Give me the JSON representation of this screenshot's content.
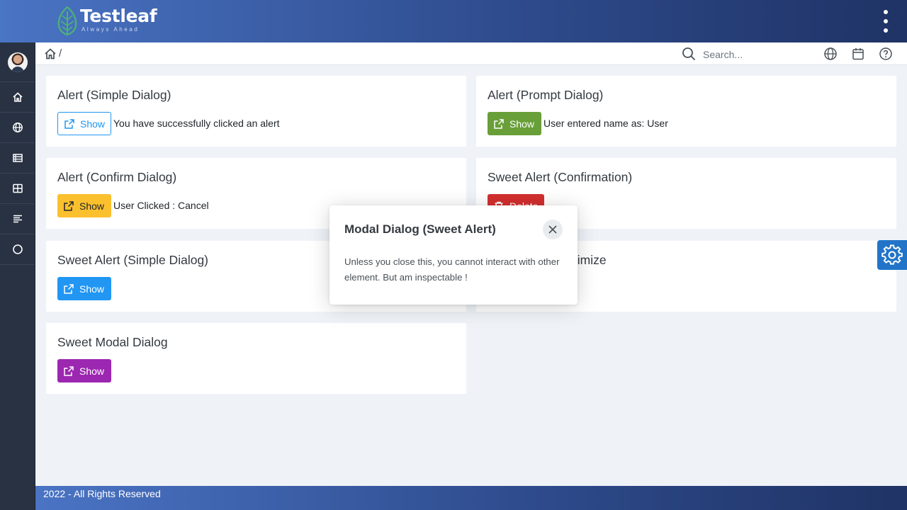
{
  "brand": {
    "name": "Testleaf",
    "tagline": "Always Ahead"
  },
  "breadcrumb": {
    "separator": "/"
  },
  "search": {
    "placeholder": "Search..."
  },
  "cards": {
    "simple_alert": {
      "title": "Alert (Simple Dialog)",
      "button": "Show",
      "result": "You have successfully clicked an alert"
    },
    "prompt_alert": {
      "title": "Alert (Prompt Dialog)",
      "button": "Show",
      "result": "User entered name as: User"
    },
    "confirm_alert": {
      "title": "Alert (Confirm Dialog)",
      "button": "Show",
      "result": "User Clicked : Cancel"
    },
    "sweet_confirm": {
      "title": "Sweet Alert (Confirmation)",
      "button": "Delete"
    },
    "sweet_simple": {
      "title": "Sweet Alert (Simple Dialog)",
      "button": "Show"
    },
    "minmax": {
      "title_visible_fragment": "ximize"
    },
    "sweet_modal": {
      "title": "Sweet Modal Dialog",
      "button": "Show"
    }
  },
  "modal": {
    "title": "Modal Dialog (Sweet Alert)",
    "body": "Unless you close this, you cannot interact with other element. But am inspectable !"
  },
  "footer": {
    "text": "2022 - All Rights Reserved"
  },
  "icons": {
    "sidebar": [
      "home-icon",
      "globe-icon",
      "list-icon",
      "grid-icon",
      "align-left-icon",
      "circle-icon"
    ],
    "topbar_right": [
      "globe-icon",
      "calendar-icon",
      "help-icon"
    ]
  },
  "colors": {
    "primary": "#2196f3",
    "success": "#689f38",
    "warning": "#fbc02d",
    "danger": "#d32f2f",
    "help": "#9c27b0",
    "sidebar": "#293242",
    "header_start": "#4a74c4",
    "header_end": "#1f3365"
  }
}
